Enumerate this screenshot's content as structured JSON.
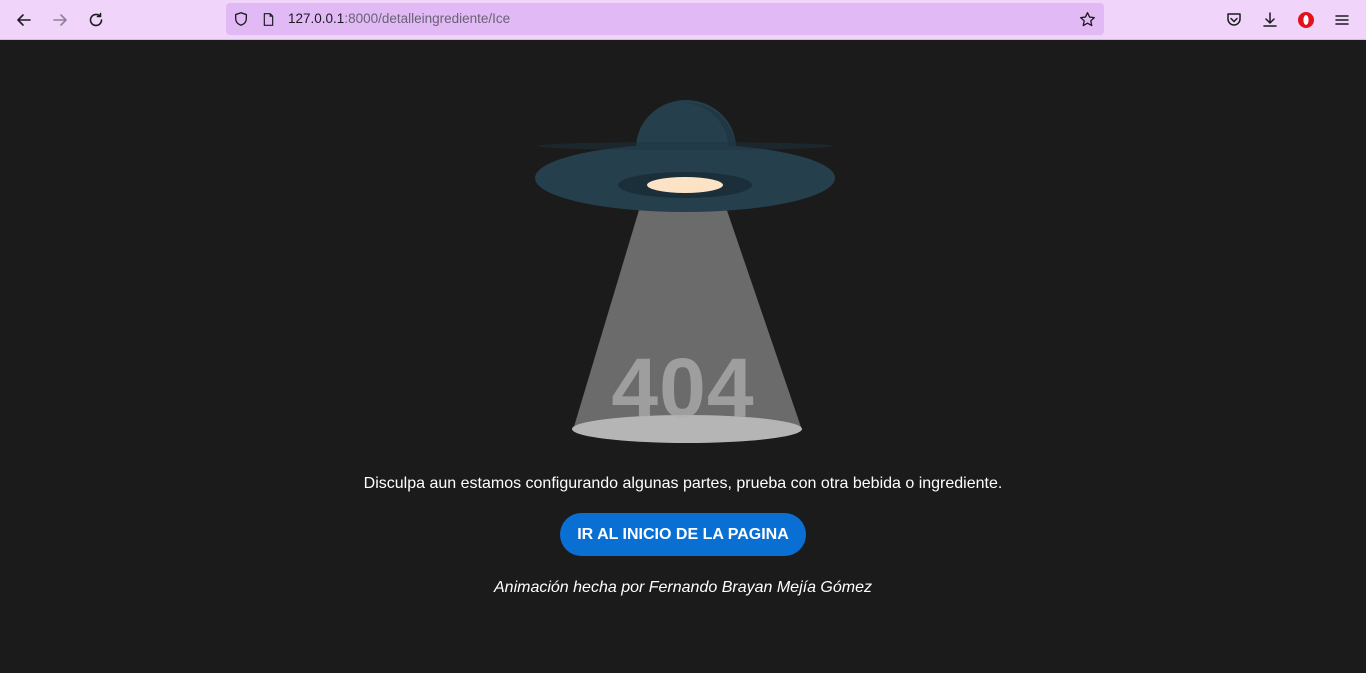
{
  "browser": {
    "url_host": "127.0.0.1",
    "url_path": ":8000/detalleingrediente/Ice",
    "icons": [
      "back-icon",
      "forward-icon",
      "reload-icon",
      "shield-icon",
      "page-icon",
      "bookmark-star-icon",
      "pocket-icon",
      "download-icon",
      "opera-icon",
      "menu-icon"
    ]
  },
  "page": {
    "error_code": "404",
    "message": "Disculpa aun estamos configurando algunas partes, prueba con otra bebida o ingrediente.",
    "home_button_label": "IR AL INICIO DE LA PAGINA",
    "credit": "Animación hecha por Fernando Brayan Mejía Gómez"
  },
  "colors": {
    "background": "#1b1b1b",
    "browser_bar": "#f0d4f9",
    "url_bar": "#e0b9f5",
    "button": "#0a6fd3",
    "ufo_body": "#263f4c",
    "ufo_light": "#fde3c6",
    "beam": "#6b6b6b"
  }
}
